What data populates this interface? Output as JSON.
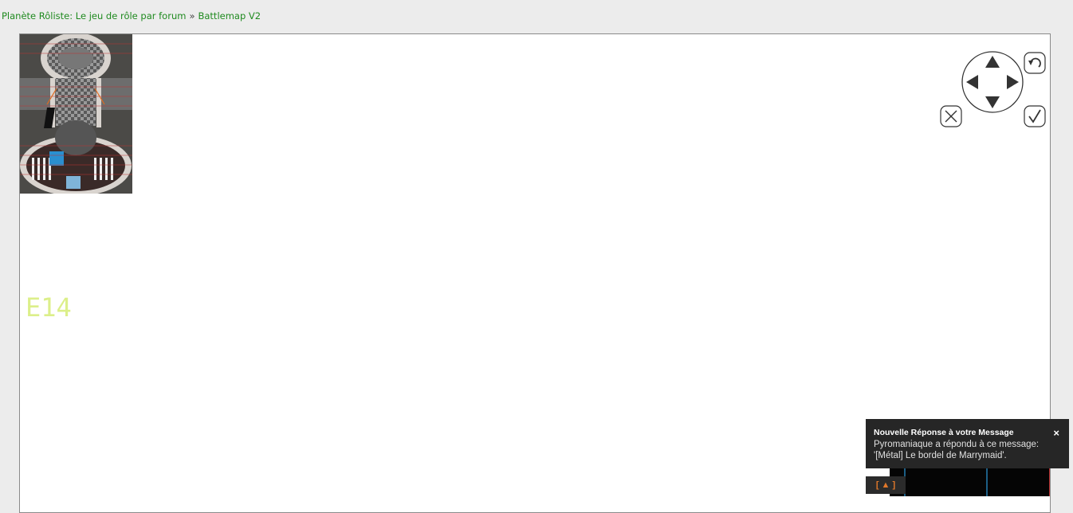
{
  "breadcrumb": {
    "home": "Planète Rôliste: Le jeu de rôle par forum",
    "separator": "»",
    "current": "Battlemap V2"
  },
  "map": {
    "cell_label": "E14",
    "cell_label_color": "#dcef8a",
    "thumbnail_icon": "battlemap-thumbnail"
  },
  "controls": {
    "dpad_icon": "dpad-icon",
    "undo_icon": "undo-icon",
    "close_icon": "close-icon",
    "confirm_icon": "checkmark-icon"
  },
  "notification": {
    "title": "Nouvelle Réponse à votre Message",
    "body": "Pyromaniaque a répondu à ce message: '[Métal] Le bordel de Marrymaid'.",
    "close_label": "×"
  },
  "footer": {
    "expand_label": "[ ▲ ]",
    "accent_color": "#e0782a"
  }
}
